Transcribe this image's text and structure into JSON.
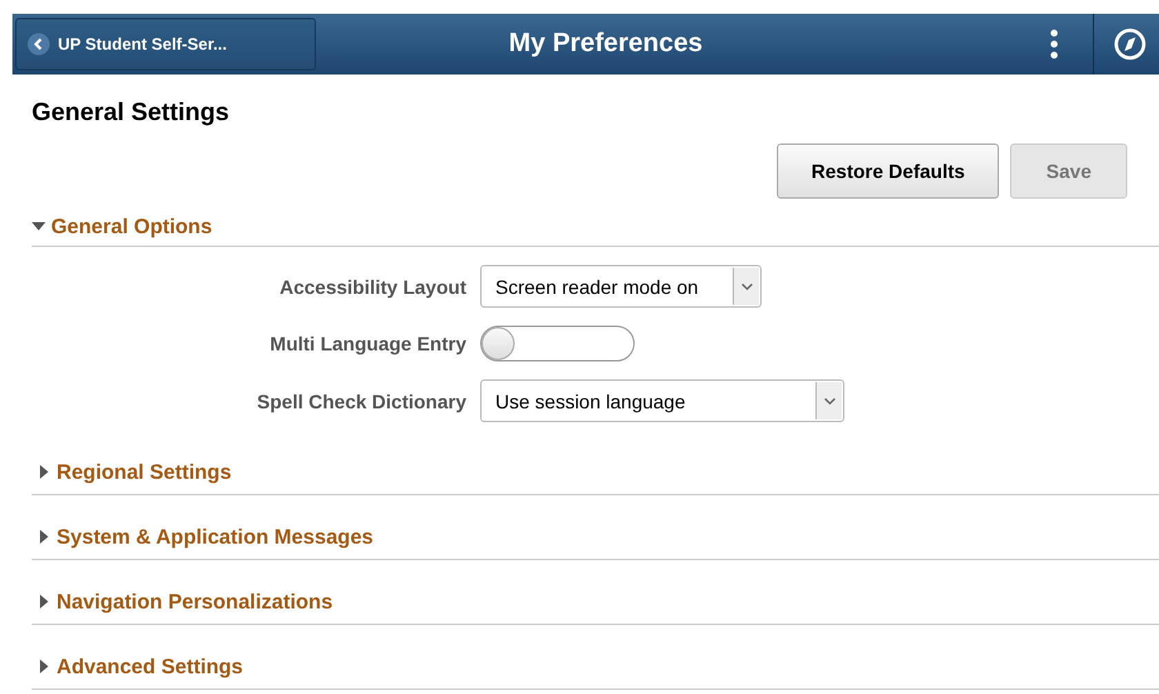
{
  "header": {
    "back_label": "UP Student Self-Ser...",
    "title": "My Preferences"
  },
  "page_title": "General Settings",
  "buttons": [
    {
      "label": "Restore Defaults",
      "disabled": false
    },
    {
      "label": "Save",
      "disabled": true
    }
  ],
  "sections": [
    {
      "title": "General Options",
      "expanded": true,
      "fields": [
        {
          "kind": "select",
          "label": "Accessibility Layout",
          "value": "Screen reader mode on",
          "wide": false
        },
        {
          "kind": "toggle",
          "label": "Multi Language Entry",
          "on": false
        },
        {
          "kind": "select",
          "label": "Spell Check Dictionary",
          "value": "Use session language",
          "wide": true
        }
      ]
    },
    {
      "title": "Regional Settings",
      "expanded": false
    },
    {
      "title": "System & Application Messages",
      "expanded": false
    },
    {
      "title": "Navigation Personalizations",
      "expanded": false
    },
    {
      "title": "Advanced Settings",
      "expanded": false
    }
  ]
}
